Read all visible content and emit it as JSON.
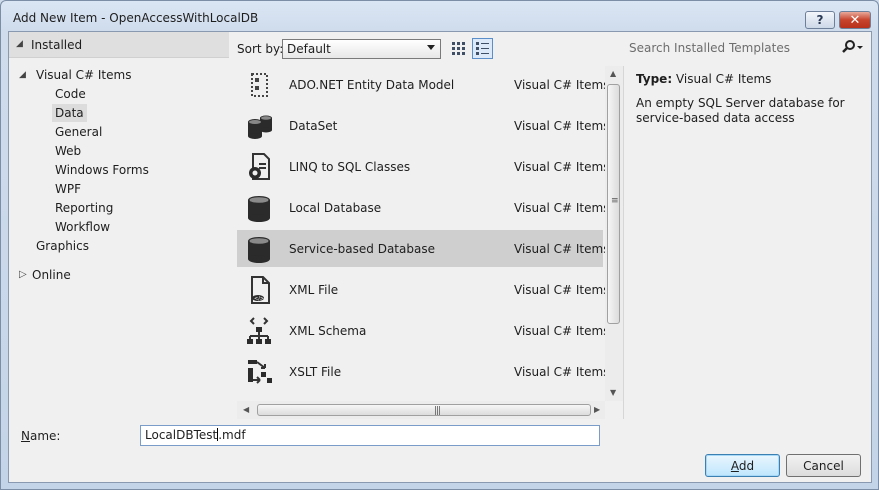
{
  "window": {
    "title": "Add New Item - OpenAccessWithLocalDB",
    "help_label": "?",
    "close_label": "✕"
  },
  "tree": {
    "installed_label": "Installed",
    "visual_csharp_label": "Visual C# Items",
    "children": [
      "Code",
      "Data",
      "General",
      "Web",
      "Windows Forms",
      "WPF",
      "Reporting",
      "Workflow"
    ],
    "selected_child": "Data",
    "graphics_label": "Graphics",
    "online_label": "Online"
  },
  "sort": {
    "label": "Sort by:",
    "selected": "Default"
  },
  "search": {
    "placeholder": "Search Installed Templates"
  },
  "templates": [
    {
      "name": "ADO.NET Entity Data Model",
      "category": "Visual C# Items",
      "icon": "entity-model-icon"
    },
    {
      "name": "DataSet",
      "category": "Visual C# Items",
      "icon": "dataset-icon"
    },
    {
      "name": "LINQ to SQL Classes",
      "category": "Visual C# Items",
      "icon": "linq-to-sql-icon"
    },
    {
      "name": "Local Database",
      "category": "Visual C# Items",
      "icon": "database-icon"
    },
    {
      "name": "Service-based Database",
      "category": "Visual C# Items",
      "icon": "database-icon",
      "selected": true
    },
    {
      "name": "XML File",
      "category": "Visual C# Items",
      "icon": "xml-file-icon"
    },
    {
      "name": "XML Schema",
      "category": "Visual C# Items",
      "icon": "xml-schema-icon"
    },
    {
      "name": "XSLT File",
      "category": "Visual C# Items",
      "icon": "xslt-file-icon"
    }
  ],
  "details": {
    "type_label": "Type:",
    "type_value": "Visual C# Items",
    "description": "An empty SQL Server database for service-based data access"
  },
  "name_field": {
    "label_prefix": "",
    "label_access": "N",
    "label_rest": "ame:",
    "value_before_caret": "LocalDBTest",
    "value_after_caret": ".mdf"
  },
  "buttons": {
    "add_access": "A",
    "add_rest": "dd",
    "cancel": "Cancel"
  },
  "colors": {
    "selection": "#cfcfcf",
    "accent": "#3c7fb1",
    "close": "#c7432c"
  }
}
